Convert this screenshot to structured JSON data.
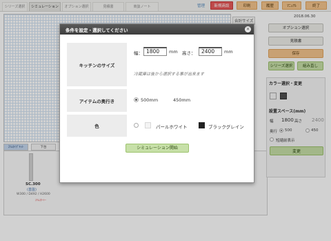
{
  "tabs": [
    {
      "label": "シリーズ選択"
    },
    {
      "label": "シミュレーション"
    },
    {
      "label": "オプション選択"
    },
    {
      "label": "見積書"
    },
    {
      "label": "商談ノート"
    }
  ],
  "header": {
    "admin_link": "管理",
    "new_project": "新規商談",
    "print": "印刷",
    "history": "履歴",
    "manual": "ﾏﾆｭｱﾙ",
    "exit": "終了"
  },
  "canvas": {
    "total_size_label": "合計サイズ",
    "fragment": "4"
  },
  "bottom": {
    "tabs": [
      {
        "label": "ｽﾘﾑﾀｲﾌﾟｷｯﾄ"
      },
      {
        "label": "下台"
      }
    ],
    "item": {
      "code": "SC.300",
      "sub": "(基盤)",
      "dims": "W300 / D492 / H2600",
      "note": "ｽﾘﾑｽﾀｰﾄｰ"
    }
  },
  "right": {
    "date": "2018.06.30",
    "option_select": "オプション選択",
    "estimate": "見積書",
    "save": "保存",
    "series_select": "シリーズ選択",
    "reassemble": "組み直し",
    "color_title": "カラー選択・変更",
    "space_title": "設置スペース(mm)",
    "width_label": "幅",
    "width_value": "1800",
    "height_label": "高さ",
    "height_value": "2400",
    "depth_label": "奥行",
    "depth_options": [
      "500",
      "450"
    ],
    "short_display": "短縮前表示",
    "change": "変更"
  },
  "colors": {
    "swatch_white": "#f5f5f5",
    "swatch_black": "#505050",
    "chip_white": "#f4f4f4",
    "chip_black": "#222222"
  },
  "dialog": {
    "title": "条件を設定・選択してください",
    "close": "×",
    "kitchen_size_label": "キッチンのサイズ",
    "width_label": "幅：",
    "width_value": "1800",
    "unit": "mm",
    "height_label": "高さ：",
    "height_value": "2400",
    "fridge_note": "冷蔵庫は後から選択する事が出来ます",
    "depth_label": "アイテムの奥行き",
    "depth_options": [
      "500mm",
      "450mm"
    ],
    "color_label": "色",
    "color_options": [
      "パールホワイト",
      "ブラックグレイン"
    ],
    "start_button": "シミュレーション開始"
  }
}
